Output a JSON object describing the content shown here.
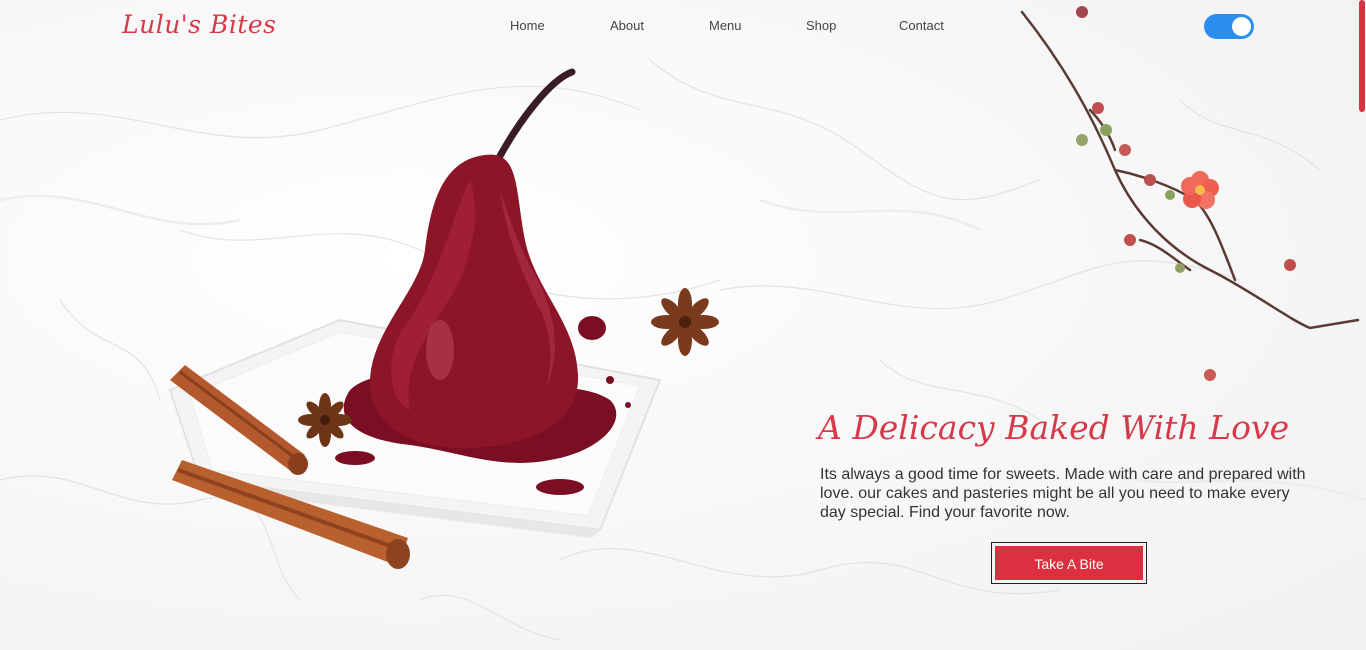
{
  "brand": {
    "logo": "Lulu's Bites"
  },
  "nav": {
    "items": [
      {
        "label": "Home"
      },
      {
        "label": "About"
      },
      {
        "label": "Menu"
      },
      {
        "label": "Shop"
      },
      {
        "label": "Contact"
      }
    ]
  },
  "theme_toggle": {
    "state": "on",
    "color": "#2b8ff0"
  },
  "hero": {
    "title": "A Delicacy Baked With Love",
    "text": "Its always a good time for sweets. Made with care and prepared with love. our cakes and pasteries might be all you need to make every day special. Find your favorite now.",
    "cta_label": "Take A Bite"
  },
  "colors": {
    "accent": "#d63a4a",
    "button": "#dc2f40",
    "toggle": "#2b8ff0"
  },
  "icons": [
    "poached-pear-image",
    "cinnamon-stick-image",
    "star-anise-image",
    "flowering-branch-image"
  ]
}
